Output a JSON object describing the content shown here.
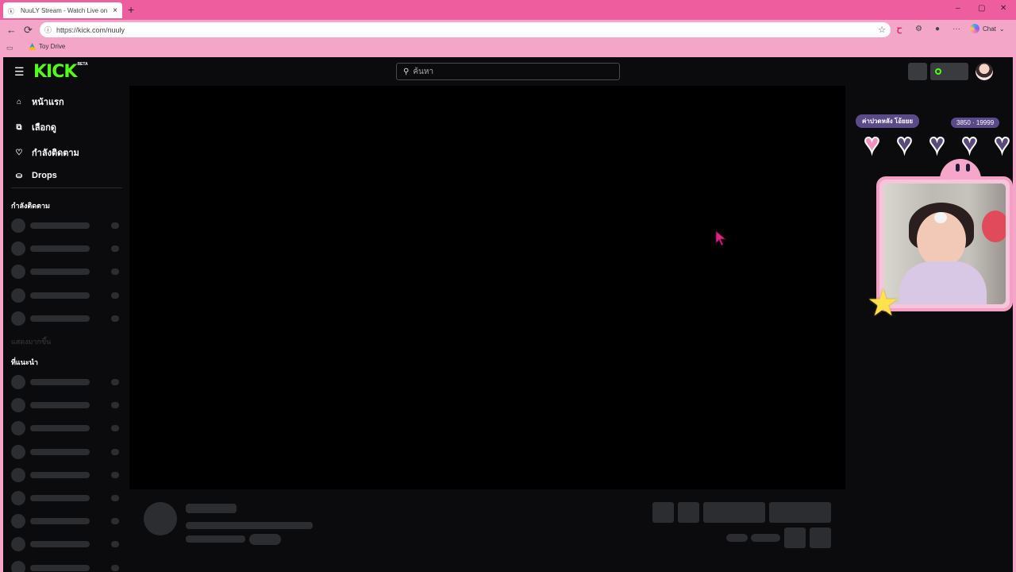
{
  "browser": {
    "tab": {
      "title": "NuuLY Stream - Watch Live on Kick",
      "favicon": "kick-favicon",
      "close": "×"
    },
    "new_tab": "+",
    "window_controls": {
      "minimize": "–",
      "maximize": "▢",
      "close": "✕"
    },
    "nav": {
      "back": "←",
      "reload": "⟳"
    },
    "url": "https://kick.com/nuuly",
    "extensions": {
      "chat_label": "Chat",
      "menu": "···"
    },
    "bookmarks": [
      {
        "label": "Toy Drive",
        "icon": "google-drive-icon"
      }
    ]
  },
  "kick": {
    "logo": "KICK",
    "logo_badge": "BETA",
    "search_placeholder": "ค้นหา",
    "sidebar": {
      "links": [
        {
          "label": "หน้าแรก",
          "icon": "home-icon"
        },
        {
          "label": "เลือกดู",
          "icon": "browse-icon"
        },
        {
          "label": "กำลังติดตาม",
          "icon": "heart-icon"
        },
        {
          "label": "Drops",
          "icon": "drops-icon"
        }
      ],
      "following_heading": "กำลังติดตาม",
      "show_more": "แสดงมากขึ้น",
      "recommended_heading": "ที่แนะนำ"
    }
  },
  "overlay": {
    "goal_label": "ค่าปวดหลัง โอ้ยยย",
    "goal_count": "3850 · 19999",
    "hearts_filled": 1,
    "hearts_total": 5,
    "colors": {
      "heart_filled": "#f48fbf",
      "heart_empty": "#5a4a7a",
      "frame": "#f3a0c4"
    }
  },
  "colors": {
    "kick_green": "#53fc18",
    "browser_pink": "#ee5e9e",
    "page_bg": "#0b0b0d"
  }
}
